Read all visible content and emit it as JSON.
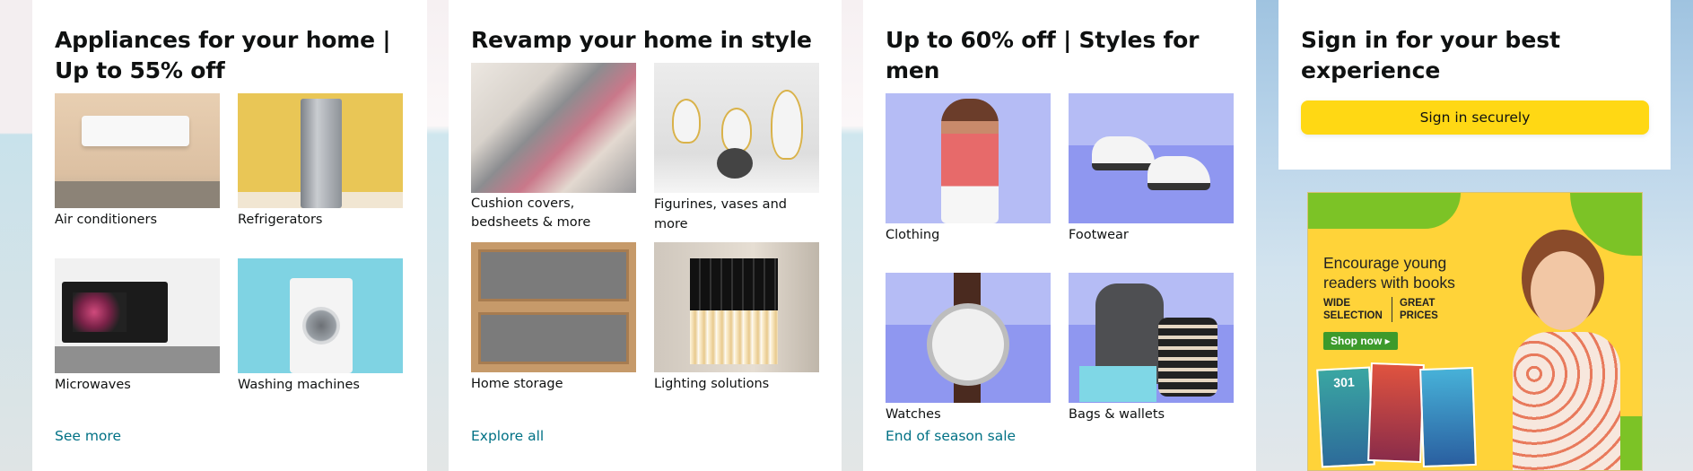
{
  "cards": [
    {
      "title": "Appliances for your home | Up to 55% off",
      "link": "See more",
      "items": [
        {
          "label": "Air conditioners",
          "icon": "air-conditioner-image"
        },
        {
          "label": "Refrigerators",
          "icon": "refrigerator-image"
        },
        {
          "label": "Microwaves",
          "icon": "microwave-image"
        },
        {
          "label": "Washing machines",
          "icon": "washing-machine-image"
        }
      ]
    },
    {
      "title": "Revamp your home in style",
      "link": "Explore all",
      "items": [
        {
          "label": "Cushion covers, bedsheets & more",
          "icon": "rug-image"
        },
        {
          "label": "Figurines, vases and more",
          "icon": "figurines-image"
        },
        {
          "label": "Home storage",
          "icon": "storage-image"
        },
        {
          "label": "Lighting solutions",
          "icon": "lamp-image"
        }
      ]
    },
    {
      "title": "Up to 60% off | Styles for men",
      "link": "End of season sale",
      "items": [
        {
          "label": "Clothing",
          "icon": "clothing-image"
        },
        {
          "label": "Footwear",
          "icon": "footwear-image"
        },
        {
          "label": "Watches",
          "icon": "watch-image"
        },
        {
          "label": "Bags & wallets",
          "icon": "bags-image"
        }
      ]
    }
  ],
  "signin": {
    "title": "Sign in for your best experience",
    "button": "Sign in securely"
  },
  "ad": {
    "headline": "Encourage young readers with books",
    "tag1": "WIDE SELECTION",
    "tag2": "GREAT PRICES",
    "cta": "Shop now ▸",
    "book_text": "301"
  },
  "colors": {
    "link": "#007185",
    "button": "#ffd814",
    "text": "#0f1111"
  }
}
